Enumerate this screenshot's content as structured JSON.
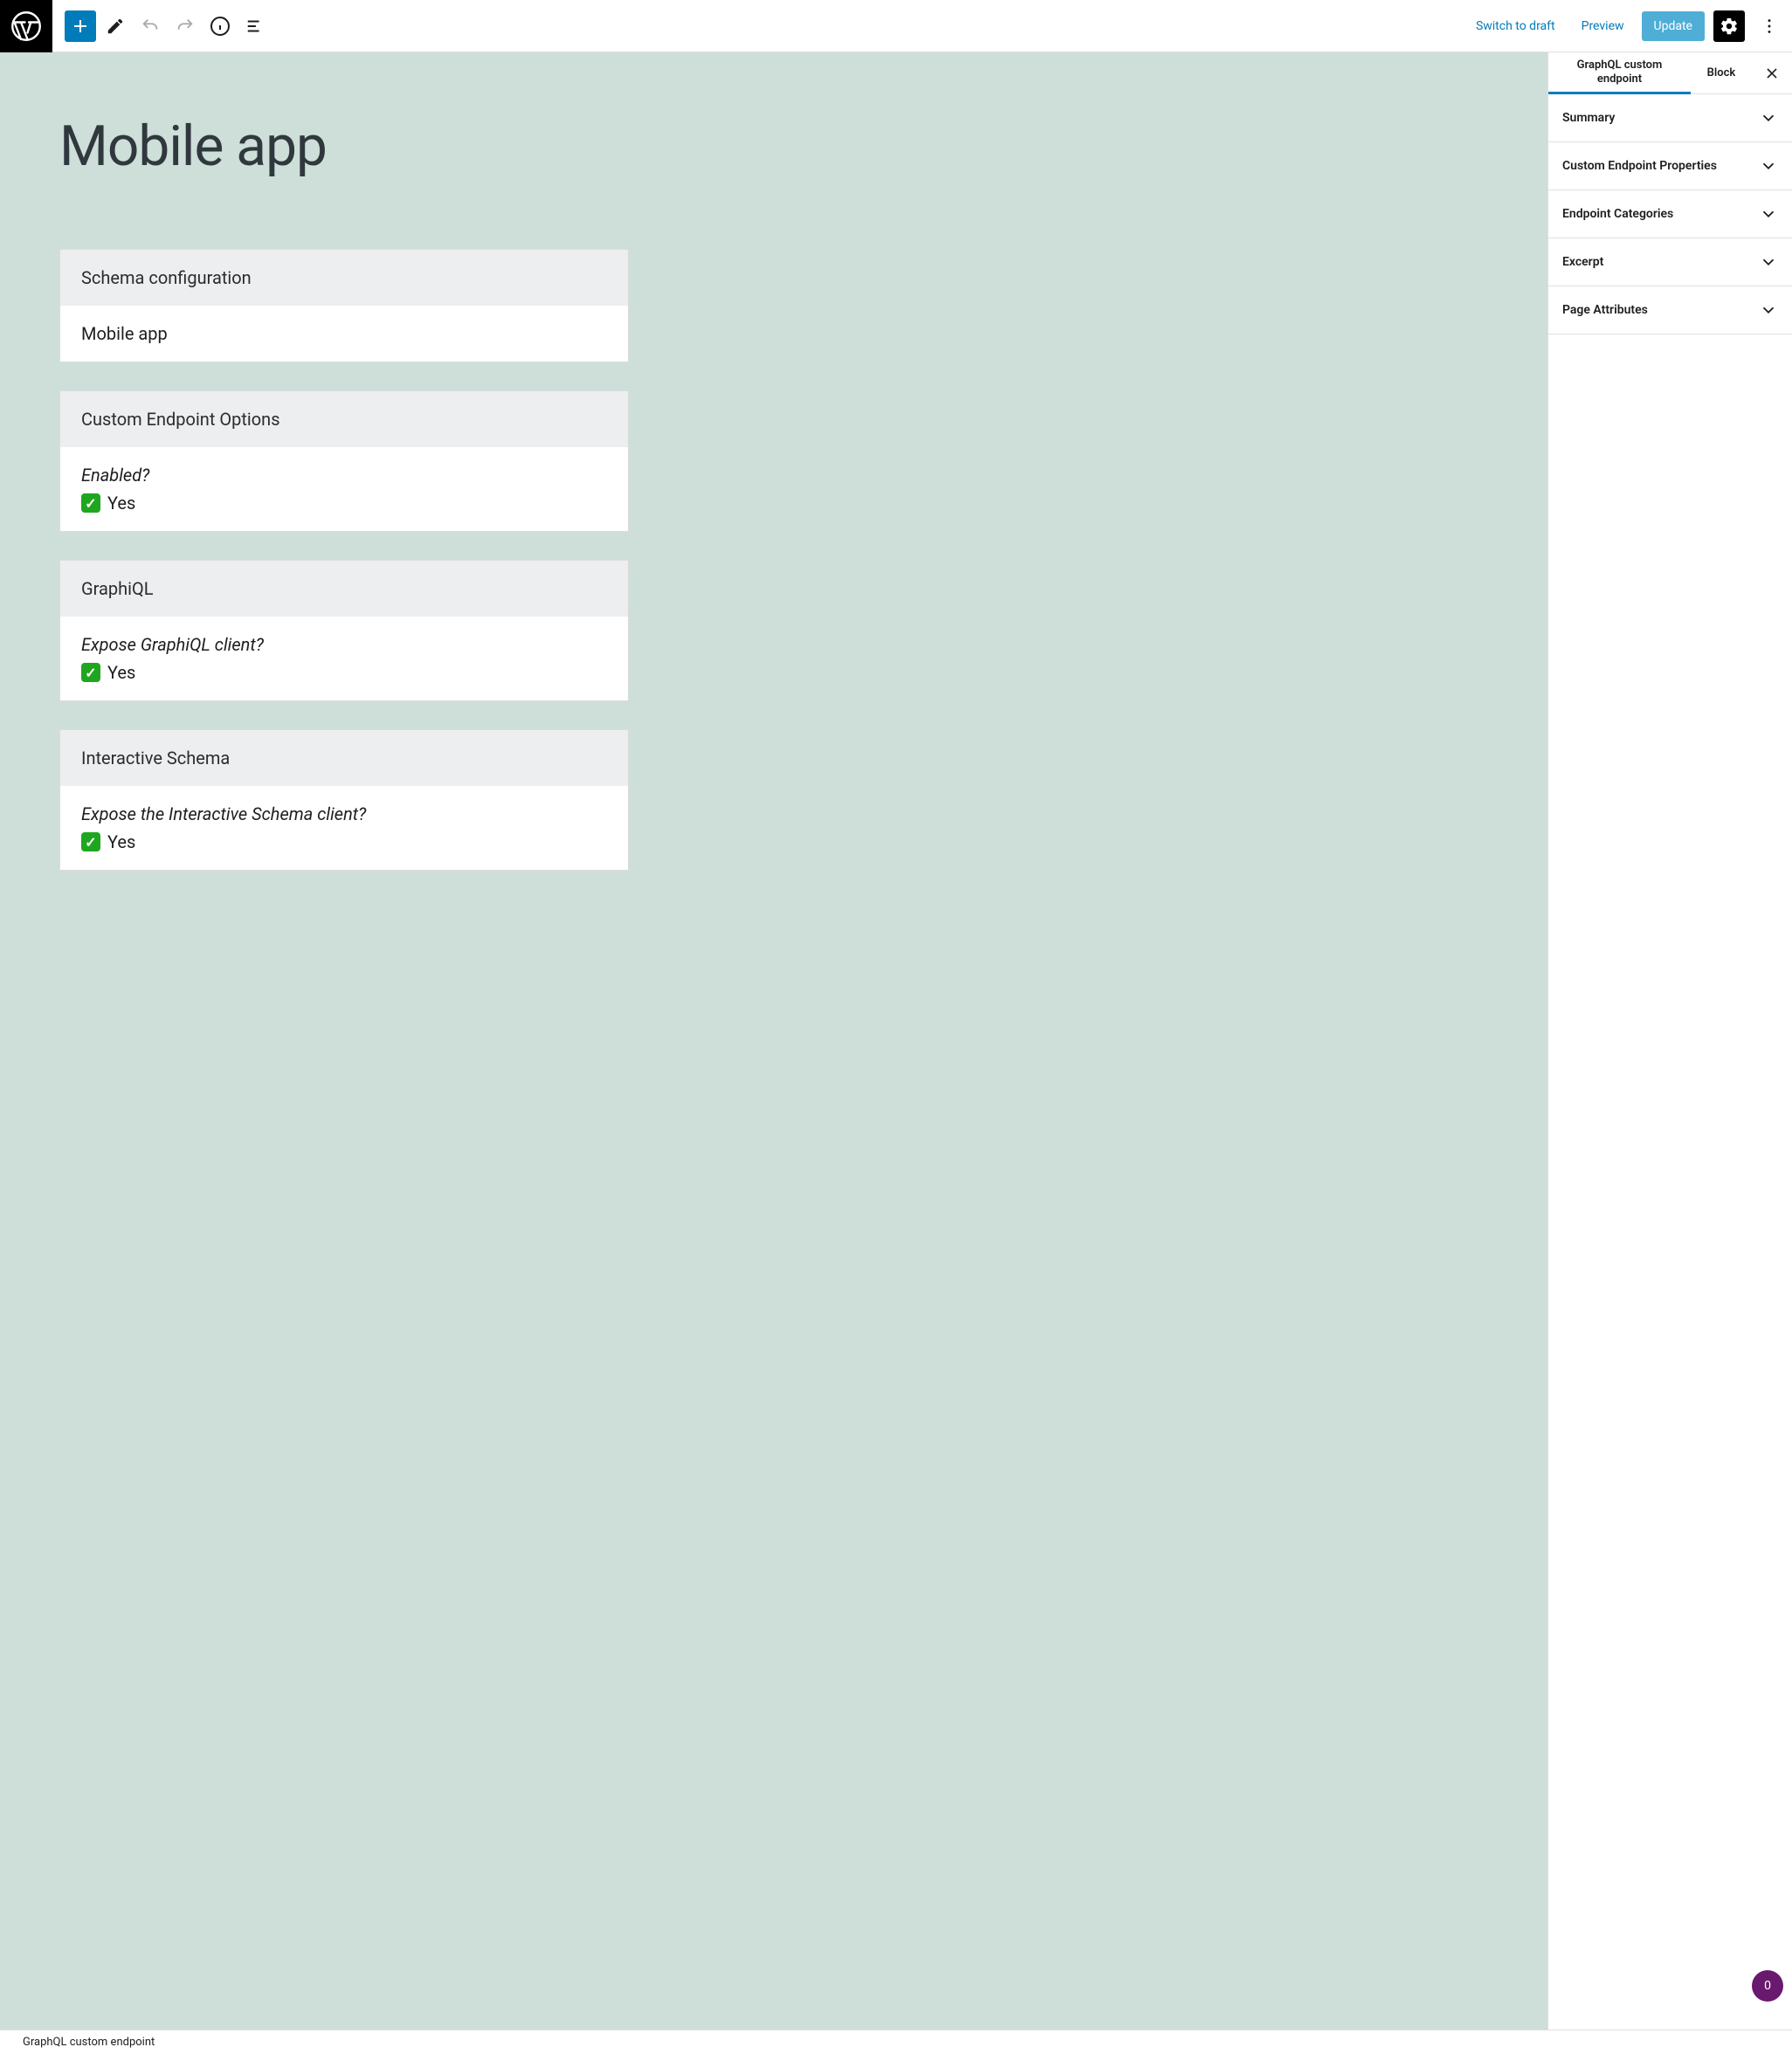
{
  "toolbar": {
    "switch_to_draft": "Switch to draft",
    "preview": "Preview",
    "update": "Update"
  },
  "post": {
    "title": "Mobile app"
  },
  "blocks": [
    {
      "header": "Schema configuration",
      "body_text": "Mobile app"
    },
    {
      "header": "Custom Endpoint Options",
      "question": "Enabled?",
      "answer": "Yes"
    },
    {
      "header": "GraphiQL",
      "question": "Expose GraphiQL client?",
      "answer": "Yes"
    },
    {
      "header": "Interactive Schema",
      "question": "Expose the Interactive Schema client?",
      "answer": "Yes"
    }
  ],
  "sidebar": {
    "tabs": {
      "graphql": "GraphQL custom endpoint",
      "block": "Block"
    },
    "panels": [
      {
        "title": "Summary"
      },
      {
        "title": "Custom Endpoint Properties"
      },
      {
        "title": "Endpoint Categories"
      },
      {
        "title": "Excerpt"
      },
      {
        "title": "Page Attributes"
      }
    ]
  },
  "breadcrumb": "GraphQL custom endpoint",
  "fab_count": "0"
}
